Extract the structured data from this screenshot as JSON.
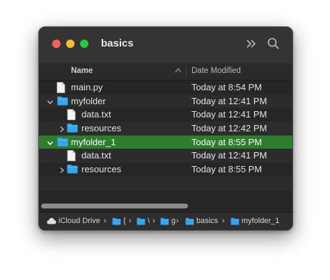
{
  "window": {
    "title": "basics"
  },
  "toolbar": {
    "more_icon": "chevron-double-right-icon",
    "search_icon": "search-icon"
  },
  "columns": {
    "name": "Name",
    "date_modified": "Date Modified"
  },
  "rows": [
    {
      "name": "main.py",
      "date": "Today at 8:54 PM",
      "type": "file",
      "disclosure": "none",
      "level": 0
    },
    {
      "name": "myfolder",
      "date": "Today at 12:41 PM",
      "type": "folder",
      "disclosure": "expanded",
      "level": 0
    },
    {
      "name": "data.txt",
      "date": "Today at 12:41 PM",
      "type": "file",
      "disclosure": "none",
      "level": 1
    },
    {
      "name": "resources",
      "date": "Today at 12:42 PM",
      "type": "folder",
      "disclosure": "collapsed",
      "level": 1
    },
    {
      "name": "myfolder_1",
      "date": "Today at 8:55 PM",
      "type": "folder",
      "disclosure": "expanded",
      "level": 0,
      "selected": true
    },
    {
      "name": "data.txt",
      "date": "Today at 12:41 PM",
      "type": "file",
      "disclosure": "none",
      "level": 1
    },
    {
      "name": "resources",
      "date": "Today at 8:55 PM",
      "type": "folder",
      "disclosure": "collapsed",
      "level": 1
    }
  ],
  "pathbar": {
    "icloud": "iCloud Drive",
    "seg1": "{",
    "seg2": "\\",
    "seg3": "g",
    "basics": "basics",
    "current": "myfolder_1"
  },
  "colors": {
    "selection": "#2e7d2e",
    "folder": "#35a6f0",
    "window_bg": "#262626"
  }
}
